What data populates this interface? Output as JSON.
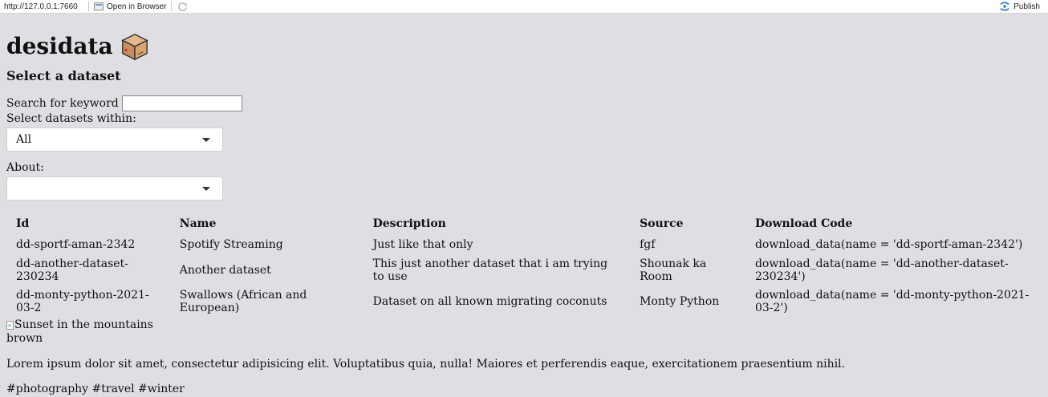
{
  "toolbar": {
    "url": "http://127.0.0.1:7660",
    "open_in_browser": "Open in Browser",
    "publish": "Publish"
  },
  "header": {
    "title": "desidata",
    "subtitle": "Select a dataset"
  },
  "form": {
    "search_label": "Search for keyword",
    "search_value": "",
    "within_label": "Select datasets within:",
    "within_value": "All",
    "about_label": "About:",
    "about_value": ""
  },
  "table": {
    "columns": [
      "Id",
      "Name",
      "Description",
      "Source",
      "Download Code"
    ],
    "rows": [
      [
        "dd-sportf-aman-2342",
        "Spotify Streaming",
        "Just like that only",
        "fgf",
        "download_data(name = 'dd-sportf-aman-2342')"
      ],
      [
        "dd-another-dataset-230234",
        "Another dataset",
        "This just another dataset that i am trying to use",
        "Shounak ka Room",
        "download_data(name = 'dd-another-dataset-230234')"
      ],
      [
        "dd-monty-python-2021-03-2",
        "Swallows (African and European)",
        "Dataset on all known migrating coconuts",
        "Monty Python",
        "download_data(name = 'dd-monty-python-2021-03-2')"
      ]
    ]
  },
  "card": {
    "image_alt": "Sunset in the mountains",
    "image_caption": "brown",
    "text": "Lorem ipsum dolor sit amet, consectetur adipisicing elit. Voluptatibus quia, nulla! Maiores et perferendis eaque, exercitationem praesentium nihil.",
    "tags": "#photography #travel #winter"
  },
  "colors": {
    "background": "#dfdfe3",
    "accent": "#2f7fd1"
  }
}
